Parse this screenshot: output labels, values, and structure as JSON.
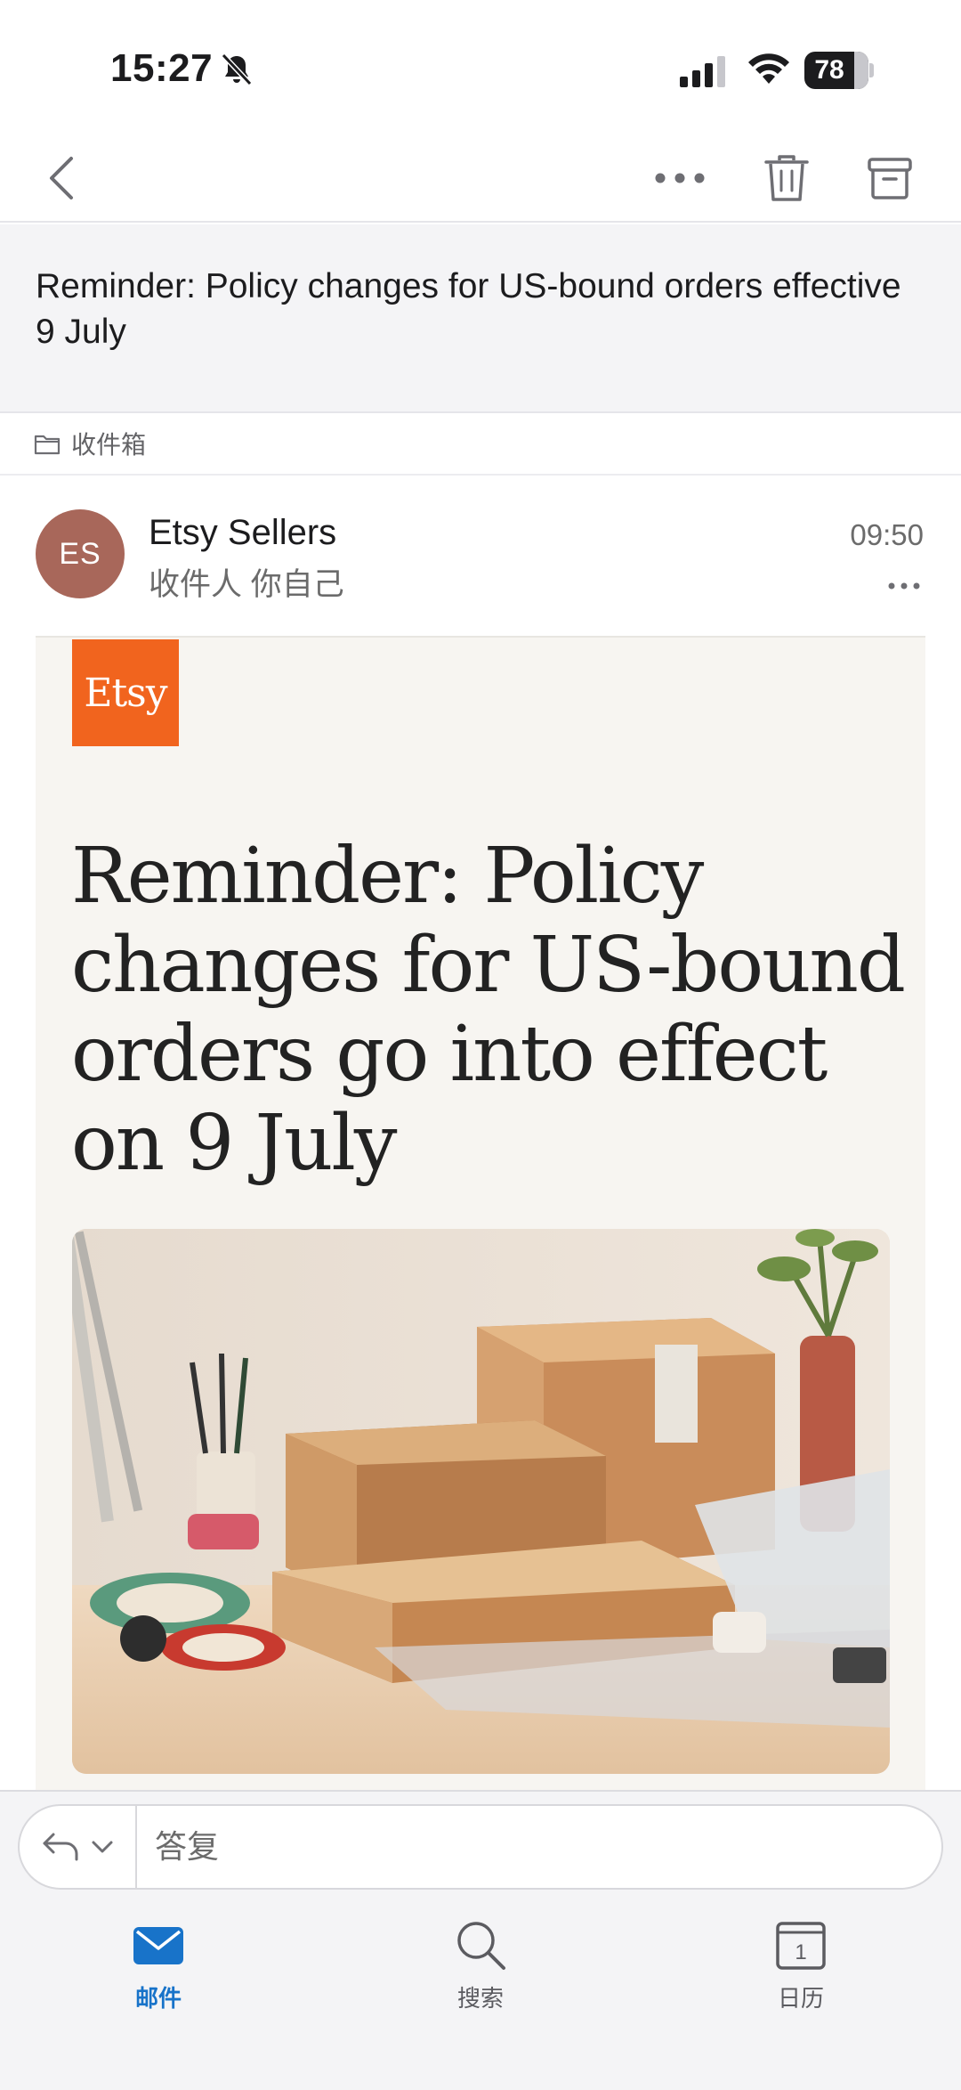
{
  "status_bar": {
    "time": "15:27",
    "battery": "78",
    "battery_level": 0.78
  },
  "nav": {
    "back": "back-icon",
    "more": "more-icon",
    "delete": "trash-icon",
    "archive": "archive-icon"
  },
  "email": {
    "subject": "Reminder: Policy changes for US-bound orders effective 9 July",
    "folder": "收件箱",
    "sender": {
      "initials": "ES",
      "name": "Etsy Sellers",
      "recipient": "收件人 你自己",
      "time": "09:50",
      "avatar_color": "#a8675a"
    },
    "body": {
      "logo_text": "Etsy",
      "logo_color": "#f1641e",
      "headline": "Reminder: Policy changes for US-bound orders go into effect on 9 July"
    }
  },
  "reply": {
    "placeholder": "答复"
  },
  "tabs": [
    {
      "label": "邮件",
      "icon": "mail-icon",
      "active": true
    },
    {
      "label": "搜索",
      "icon": "search-icon",
      "active": false
    },
    {
      "label": "日历",
      "icon": "calendar-icon",
      "day": "1",
      "active": false
    }
  ],
  "colors": {
    "accent": "#1873c9"
  }
}
